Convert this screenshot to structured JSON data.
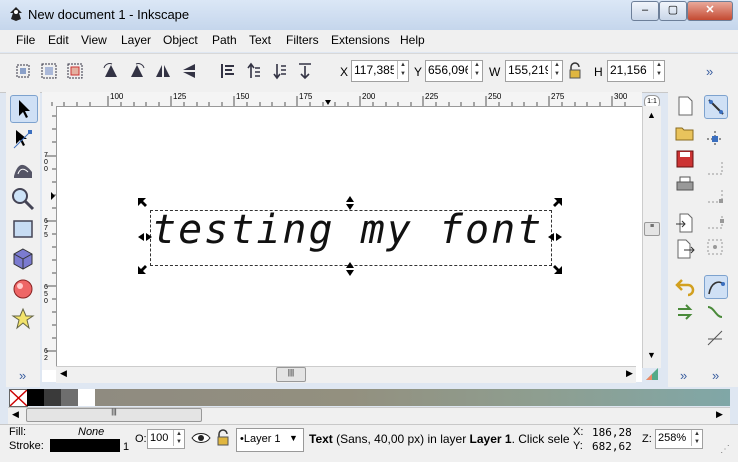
{
  "window": {
    "title": "New document 1 - Inkscape"
  },
  "menu": [
    "File",
    "Edit",
    "View",
    "Layer",
    "Object",
    "Path",
    "Text",
    "Filters",
    "Extensions",
    "Help"
  ],
  "toolbar": {
    "x_label": "X",
    "x_value": "117,385",
    "y_label": "Y",
    "y_value": "656,096",
    "w_label": "W",
    "w_value": "155,219",
    "h_label": "H",
    "h_value": "21,156",
    "more": "»"
  },
  "ruler": {
    "h_ticks": [
      "100",
      "125",
      "150",
      "175",
      "200",
      "225",
      "250",
      "275",
      "300"
    ],
    "v_labels": [
      "7\n0\n0",
      "6\n7\n5",
      "6\n5\n0",
      "6\n2"
    ],
    "zoom_icon": "1:1"
  },
  "canvas": {
    "text": "testing my font"
  },
  "toolbox": {
    "more": "»"
  },
  "commands": {
    "more": "»"
  },
  "snap": {
    "more": "»"
  },
  "palette": {
    "colors": [
      "#000000",
      "#3a3a3a",
      "#6e6e6e",
      "#ffffff",
      "#8f8b80",
      "#93907f",
      "#8e9e90",
      "#86a79e",
      "#80a7a7"
    ]
  },
  "status": {
    "fill_label": "Fill:",
    "fill_value": "None",
    "stroke_label": "Stroke:",
    "stroke_width": "1",
    "opacity_label": "O:",
    "opacity_value": "100",
    "layer_name": "•Layer 1",
    "message_bold": "Text",
    "message_rest": " (Sans, 40,00 px) in layer ",
    "message_layer": "Layer 1",
    "message_tail": ". Click selecti",
    "cursor_x_label": "X:",
    "cursor_x": "186,28",
    "cursor_y_label": "Y:",
    "cursor_y": "682,62",
    "zoom_label": "Z:",
    "zoom_value": "258%"
  }
}
